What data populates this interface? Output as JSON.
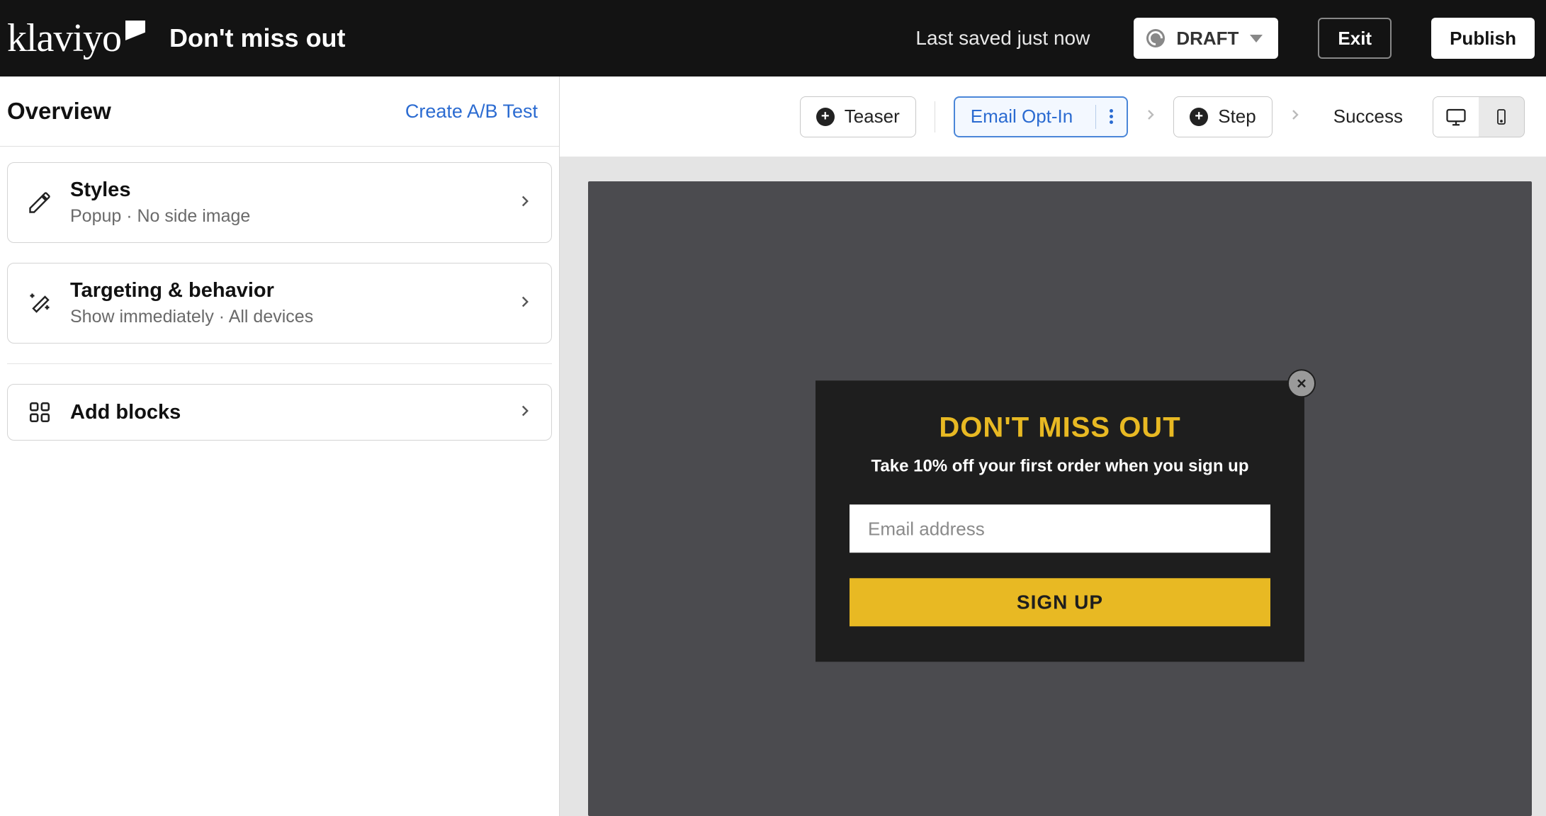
{
  "header": {
    "brand": "klaviyo",
    "form_name": "Don't miss out",
    "last_saved": "Last saved just now",
    "status_label": "DRAFT",
    "exit_label": "Exit",
    "publish_label": "Publish"
  },
  "sidebar": {
    "title": "Overview",
    "ab_link": "Create A/B Test",
    "cards": [
      {
        "title": "Styles",
        "subtitle": "Popup · No side image"
      },
      {
        "title": "Targeting & behavior",
        "subtitle": "Show immediately · All devices"
      },
      {
        "title": "Add blocks",
        "subtitle": ""
      }
    ]
  },
  "steps": {
    "teaser": "Teaser",
    "email_opt_in": "Email Opt-In",
    "step": "Step",
    "success": "Success"
  },
  "popup": {
    "heading": "DON'T MISS OUT",
    "subheading": "Take 10% off your first order when you sign up",
    "email_placeholder": "Email address",
    "button_label": "SIGN UP"
  }
}
